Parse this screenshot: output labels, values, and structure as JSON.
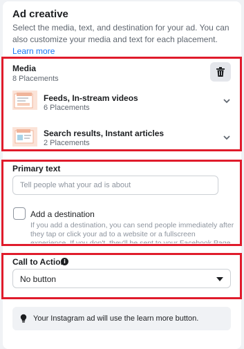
{
  "header": {
    "title": "Ad creative",
    "description": "Select the media, text, and destination for your ad. You can also customize your media and text for each placement.",
    "learn_more": "Learn more"
  },
  "media": {
    "label": "Media",
    "count": "8 Placements",
    "rows": [
      {
        "title": "Feeds, In-stream videos",
        "subtitle": "6 Placements",
        "thumb_text": "Your First Facebook"
      },
      {
        "title": "Search results, Instant articles",
        "subtitle": "2 Placements",
        "thumb_text": "Your First Facebook"
      }
    ]
  },
  "primary_text": {
    "label": "Primary text",
    "placeholder": "Tell people what your ad is about"
  },
  "destination": {
    "label": "Add a destination",
    "help": "If you add a destination, you can send people immediately after they tap or click your ad to a website or a fullscreen experience. If you don't, they'll be sent to your Facebook Page or Instagram account."
  },
  "cta": {
    "label": "Call to Action",
    "selected": "No button"
  },
  "notice": {
    "text": "Your Instagram ad will use the learn more button."
  },
  "colors": {
    "highlight": "#e01b2b",
    "link": "#1877f2",
    "thumb_accent": "#f0b49a"
  }
}
